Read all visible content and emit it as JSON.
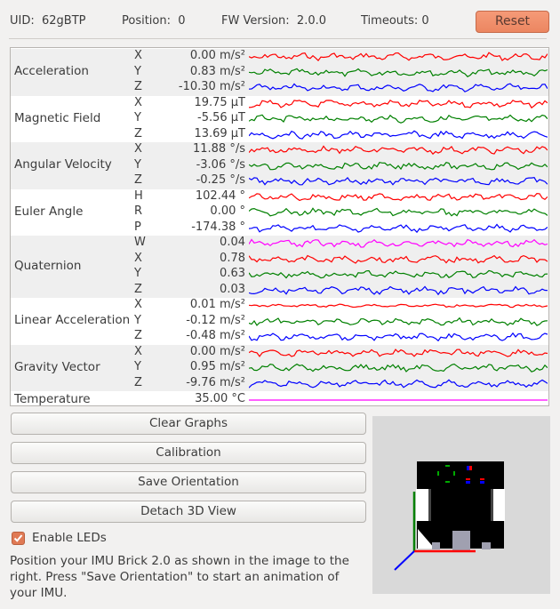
{
  "header": {
    "uid_label": "UID:",
    "uid_value": "62gBTP",
    "position_label": "Position:",
    "position_value": "0",
    "fw_label": "FW Version:",
    "fw_value": "2.0.0",
    "timeouts_label": "Timeouts:",
    "timeouts_value": "0",
    "reset_label": "Reset"
  },
  "colors": {
    "red": "#ff0000",
    "green": "#008000",
    "blue": "#0000ff",
    "magenta": "#ff00ff",
    "accent": "#ec8660"
  },
  "sensors": [
    {
      "title": "Acceleration",
      "rows": [
        {
          "axis": "X",
          "value": "0.00 m/s²",
          "color": "red"
        },
        {
          "axis": "Y",
          "value": "0.83 m/s²",
          "color": "green"
        },
        {
          "axis": "Z",
          "value": "-10.30 m/s²",
          "color": "blue"
        }
      ]
    },
    {
      "title": "Magnetic Field",
      "rows": [
        {
          "axis": "X",
          "value": "19.75 µT",
          "color": "red"
        },
        {
          "axis": "Y",
          "value": "-5.56 µT",
          "color": "green"
        },
        {
          "axis": "Z",
          "value": "13.69 µT",
          "color": "blue"
        }
      ]
    },
    {
      "title": "Angular Velocity",
      "rows": [
        {
          "axis": "X",
          "value": "11.88 °/s",
          "color": "red"
        },
        {
          "axis": "Y",
          "value": "-3.06 °/s",
          "color": "green"
        },
        {
          "axis": "Z",
          "value": "-0.25 °/s",
          "color": "blue"
        }
      ]
    },
    {
      "title": "Euler Angle",
      "rows": [
        {
          "axis": "H",
          "value": "102.44 °",
          "color": "red"
        },
        {
          "axis": "R",
          "value": "0.00 °",
          "color": "green"
        },
        {
          "axis": "P",
          "value": "-174.38 °",
          "color": "blue"
        }
      ]
    },
    {
      "title": "Quaternion",
      "rows": [
        {
          "axis": "W",
          "value": "0.04",
          "color": "magenta"
        },
        {
          "axis": "X",
          "value": "0.78",
          "color": "red"
        },
        {
          "axis": "Y",
          "value": "0.63",
          "color": "green"
        },
        {
          "axis": "Z",
          "value": "0.03",
          "color": "blue"
        }
      ]
    },
    {
      "title": "Linear Acceleration",
      "rows": [
        {
          "axis": "X",
          "value": "0.01 m/s²",
          "color": "red"
        },
        {
          "axis": "Y",
          "value": "-0.12 m/s²",
          "color": "green"
        },
        {
          "axis": "Z",
          "value": "-0.48 m/s²",
          "color": "blue"
        }
      ]
    },
    {
      "title": "Gravity Vector",
      "rows": [
        {
          "axis": "X",
          "value": "0.00 m/s²",
          "color": "red"
        },
        {
          "axis": "Y",
          "value": "0.95 m/s²",
          "color": "green"
        },
        {
          "axis": "Z",
          "value": "-9.76 m/s²",
          "color": "blue"
        }
      ]
    },
    {
      "title": "Temperature",
      "rows": [
        {
          "axis": "",
          "value": "35.00 °C",
          "color": "magenta"
        }
      ]
    }
  ],
  "buttons": {
    "clear_graphs": "Clear Graphs",
    "calibration": "Calibration",
    "save_orientation": "Save Orientation",
    "detach_3d": "Detach 3D View"
  },
  "enable_leds": {
    "label": "Enable LEDs",
    "checked": true
  },
  "info_text": "Position your IMU Brick 2.0 as shown in the image to the right. Press \"Save Orientation\" to start an animation of your IMU."
}
